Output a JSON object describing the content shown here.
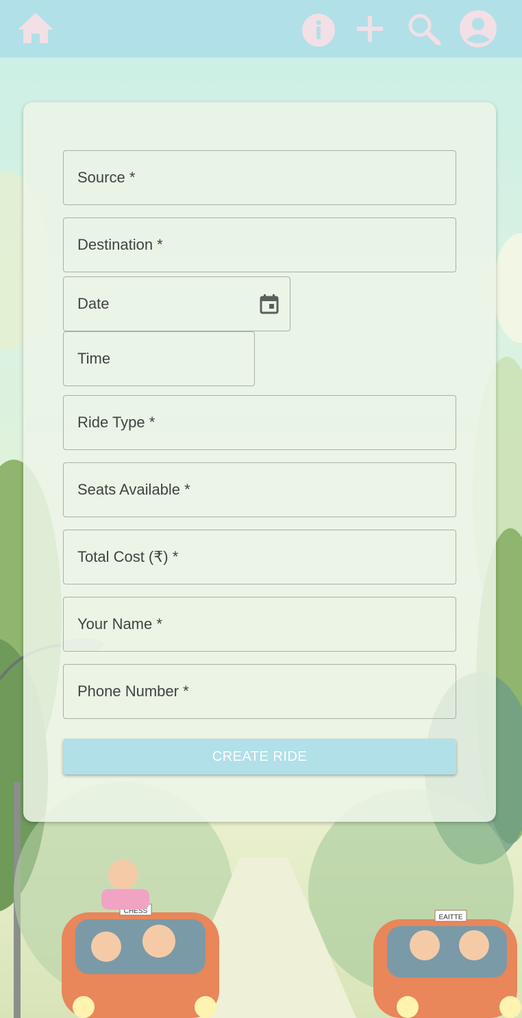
{
  "navbar": {
    "icons": [
      "home-icon",
      "info-icon",
      "add-icon",
      "search-icon",
      "account-icon"
    ],
    "background": "#b1e0e8",
    "icon_color": "#f3dfe6"
  },
  "form": {
    "source_label": "Source *",
    "destination_label": "Destination *",
    "date_label": "Date",
    "time_label": "Time",
    "ride_type_label": "Ride Type *",
    "seats_label": "Seats Available *",
    "cost_label": "Total Cost (₹) *",
    "name_label": "Your Name *",
    "phone_label": "Phone Number *",
    "date_icon": "calendar-icon",
    "submit_label": "CREATE RIDE"
  },
  "background_scene": {
    "car_left_sign": "CHESS",
    "car_right_sign": "EAITTE"
  }
}
